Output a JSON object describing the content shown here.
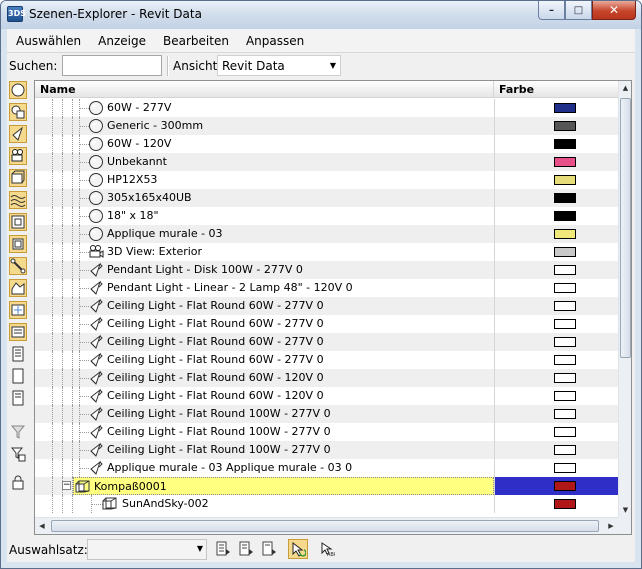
{
  "window": {
    "title": "Szenen-Explorer - Revit Data",
    "app_icon_text": "3DS",
    "buttons": [
      "minimize",
      "maximize",
      "close"
    ]
  },
  "menu": [
    "Auswählen",
    "Anzeige",
    "Bearbeiten",
    "Anpassen"
  ],
  "search": {
    "label": "Suchen:",
    "value": ""
  },
  "view": {
    "label": "Ansicht:",
    "value": "Revit Data"
  },
  "columns": {
    "name": "Name",
    "color": "Farbe"
  },
  "rows": [
    {
      "label": "60W - 277V",
      "icon": "sphere-icon",
      "color": "#1f2f8a"
    },
    {
      "label": "Generic - 300mm",
      "icon": "sphere-icon",
      "color": "#555555"
    },
    {
      "label": "60W - 120V",
      "icon": "sphere-icon",
      "color": "#000000"
    },
    {
      "label": "Unbekannt",
      "icon": "sphere-icon",
      "color": "#e8508a"
    },
    {
      "label": "HP12X53",
      "icon": "sphere-icon",
      "color": "#e6dc7a"
    },
    {
      "label": "305x165x40UB",
      "icon": "sphere-icon",
      "color": "#000000"
    },
    {
      "label": "18\" x 18\"",
      "icon": "sphere-icon",
      "color": "#000000"
    },
    {
      "label": "Applique murale - 03",
      "icon": "sphere-icon",
      "color": "#f0e87a"
    },
    {
      "label": "3D View: Exterior",
      "icon": "camera-icon",
      "color": "#c8c8c8"
    },
    {
      "label": "Pendant Light - Disk 100W - 277V 0",
      "icon": "spotlight-icon",
      "color": "#ffffff"
    },
    {
      "label": "Pendant Light - Linear - 2 Lamp 48\" - 120V 0",
      "icon": "spotlight-icon",
      "color": "#ffffff"
    },
    {
      "label": "Ceiling Light - Flat Round 60W - 277V 0",
      "icon": "spotlight-icon",
      "color": "#ffffff"
    },
    {
      "label": "Ceiling Light - Flat Round 60W - 277V 0",
      "icon": "spotlight-icon",
      "color": "#ffffff"
    },
    {
      "label": "Ceiling Light - Flat Round 60W - 277V 0",
      "icon": "spotlight-icon",
      "color": "#ffffff"
    },
    {
      "label": "Ceiling Light - Flat Round 60W - 277V 0",
      "icon": "spotlight-icon",
      "color": "#ffffff"
    },
    {
      "label": "Ceiling Light - Flat Round 60W - 120V 0",
      "icon": "spotlight-icon",
      "color": "#ffffff"
    },
    {
      "label": "Ceiling Light - Flat Round 60W - 120V 0",
      "icon": "spotlight-icon",
      "color": "#ffffff"
    },
    {
      "label": "Ceiling Light - Flat Round 100W - 277V 0",
      "icon": "spotlight-icon",
      "color": "#ffffff"
    },
    {
      "label": "Ceiling Light - Flat Round 100W - 277V 0",
      "icon": "spotlight-icon",
      "color": "#ffffff"
    },
    {
      "label": "Ceiling Light - Flat Round 100W - 277V 0",
      "icon": "spotlight-icon",
      "color": "#ffffff"
    },
    {
      "label": "Applique murale - 03 Applique murale - 03 0",
      "icon": "spotlight-icon",
      "color": "#ffffff"
    },
    {
      "label": "Kompaß0001",
      "icon": "helper-icon",
      "color": "#b01818",
      "selected": true,
      "expander": "−"
    },
    {
      "label": "SunAndSky-002",
      "icon": "helper-icon",
      "color": "#b01818",
      "child": true
    }
  ],
  "bottom": {
    "label": "Auswahlsatz:",
    "value": ""
  },
  "left_toolbar": [
    "display-geometry-icon",
    "display-shapes-icon",
    "display-lights-icon",
    "display-cameras-icon",
    "display-helpers-icon",
    "display-spacewarps-icon",
    "display-groups-icon",
    "display-xrefs-icon",
    "display-bones-icon",
    "display-containers-icon",
    "display-frozen-icon",
    "display-hidden-icon",
    "display-all-icon",
    "display-none-icon",
    "invert-display-icon",
    "filter-icon",
    "filter-settings-icon",
    "lock-icon"
  ]
}
